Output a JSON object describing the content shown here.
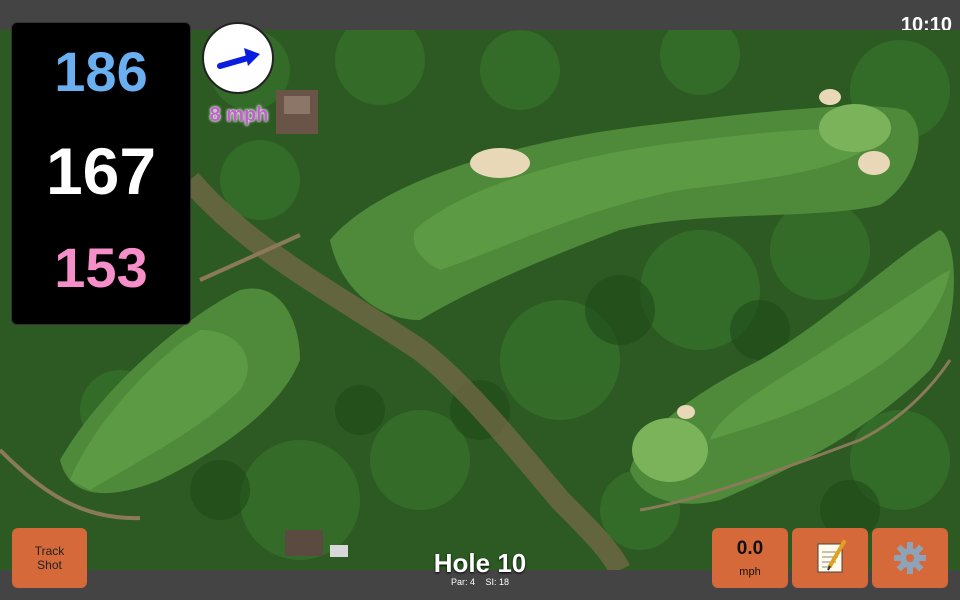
{
  "status_bar": {
    "time": "10:10"
  },
  "distances": {
    "back": "186",
    "middle": "167",
    "front": "153"
  },
  "wind": {
    "speed_label": "8 mph",
    "direction_icon": "arrow-east-northeast-icon"
  },
  "hole": {
    "title": "Hole 10",
    "par_label": "Par: 4",
    "stroke_index_label": "SI: 18"
  },
  "buttons": {
    "track_shot_line1": "Track",
    "track_shot_line2": "Shot",
    "wind_value": "0.0",
    "wind_unit": "mph",
    "notes_icon": "notepad-icon",
    "settings_icon": "gear-icon"
  },
  "colors": {
    "back_distance": "#6ab0f0",
    "middle_distance": "#ffffff",
    "front_distance": "#f58ec9",
    "button_bg": "#d5693a",
    "wind_arrow": "#0a1ee0"
  }
}
